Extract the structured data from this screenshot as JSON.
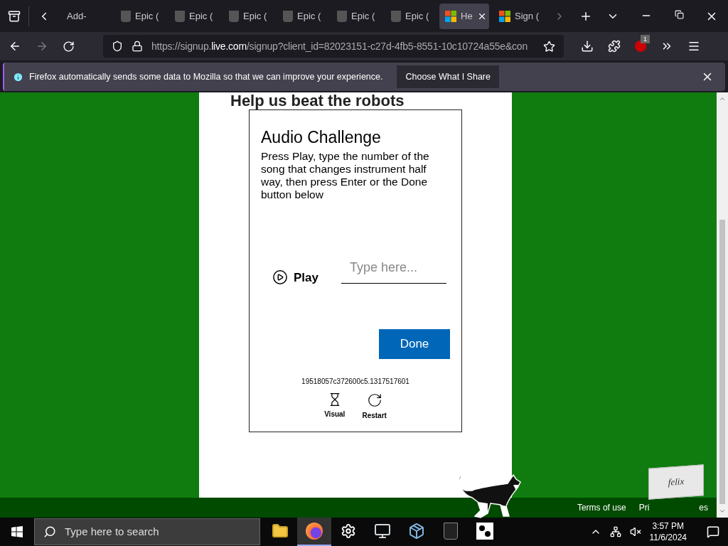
{
  "browser": {
    "tabs": [
      {
        "label": "Add-",
        "kind": "plain",
        "selected": false
      },
      {
        "label": "Epic (",
        "kind": "shield",
        "selected": false
      },
      {
        "label": "Epic (",
        "kind": "shield",
        "selected": false
      },
      {
        "label": "Epic (",
        "kind": "shield",
        "selected": false
      },
      {
        "label": "Epic (",
        "kind": "shield",
        "selected": false
      },
      {
        "label": "Epic (",
        "kind": "shield",
        "selected": false
      },
      {
        "label": "Epic (",
        "kind": "shield",
        "selected": false
      },
      {
        "label": "He",
        "kind": "squares",
        "selected": true
      },
      {
        "label": "Sign (",
        "kind": "squares",
        "selected": false
      }
    ],
    "url": {
      "prefix": "https://signup.",
      "domain": "live.com",
      "rest": "/signup?client_id=82023151-c27d-4fb5-8551-10c10724a55e&con"
    },
    "extension_badge": "1",
    "notice": {
      "text": "Firefox automatically sends some data to Mozilla so that we can improve your experience.",
      "button": "Choose What I Share"
    }
  },
  "page": {
    "heading": "Help us beat the robots",
    "challenge": {
      "title": "Audio Challenge",
      "instructions": "Press Play, type the number of the song that changes instrument half way, then press Enter or the Done button below",
      "play": "Play",
      "placeholder": "Type here...",
      "done": "Done",
      "code": "19518057c372600c5.1317517601",
      "options": [
        {
          "label": "Visual",
          "kind": "visual"
        },
        {
          "label": "Restart",
          "kind": "restart"
        }
      ]
    },
    "footer": [
      "Terms of use",
      "Pri",
      "es"
    ],
    "box_label": "felix"
  },
  "taskbar": {
    "search_placeholder": "Type here to search",
    "apps": [
      {
        "kind": "folder",
        "active": false
      },
      {
        "kind": "firefox",
        "active": true
      },
      {
        "kind": "settings",
        "active": false
      },
      {
        "kind": "monitor",
        "active": false
      },
      {
        "kind": "installer",
        "active": false
      },
      {
        "kind": "epic",
        "active": false
      },
      {
        "kind": "paws",
        "active": false
      }
    ],
    "time": "3:57 PM",
    "date": "11/6/2024"
  }
}
